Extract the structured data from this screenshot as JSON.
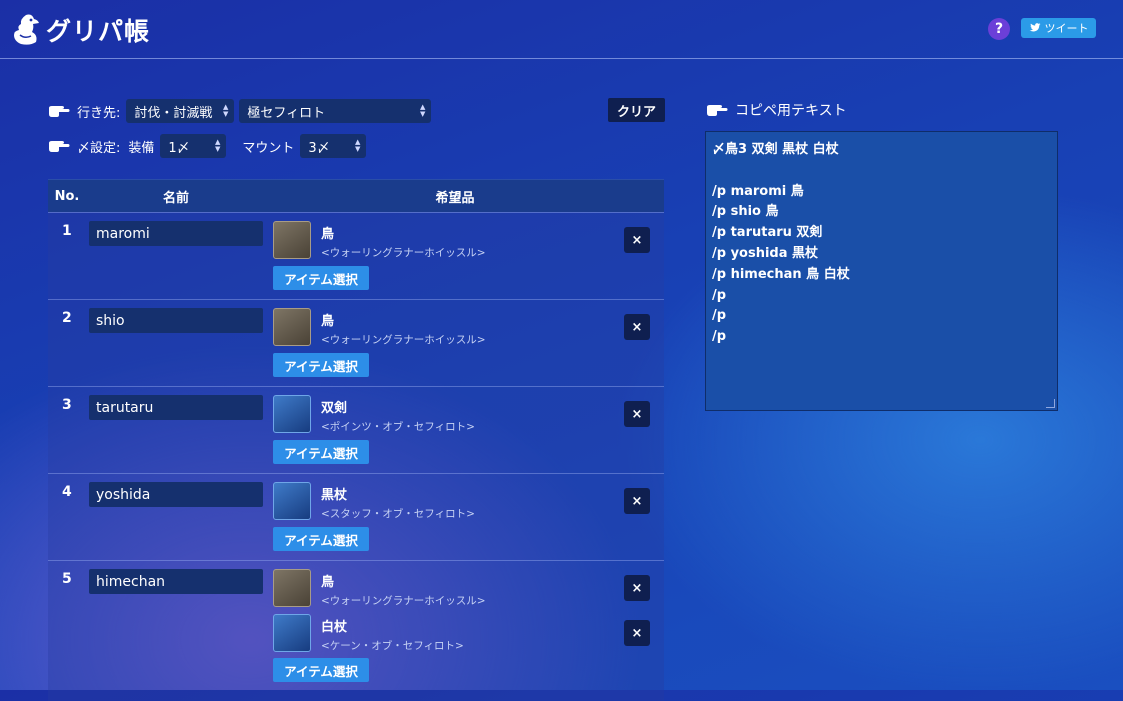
{
  "app": {
    "title": "グリパ帳",
    "help_label": "?",
    "tweet_label": "ツイート"
  },
  "controls": {
    "destination_label": "行き先:",
    "destination_category": "討伐・討滅戦",
    "destination_duty": "極セフィロト",
    "settings_label": "〆設定:",
    "equip_label": "装備",
    "equip_value": "1〆",
    "mount_label": "マウント",
    "mount_value": "3〆",
    "clear_label": "クリア"
  },
  "table": {
    "headers": {
      "no": "No.",
      "name": "名前",
      "wish": "希望品"
    },
    "pick_label": "アイテム選択",
    "remove_label": "×",
    "rows": [
      {
        "no": "1",
        "name": "maromi",
        "items": [
          {
            "name": "鳥",
            "sub": "<ウォーリングラナーホイッスル>",
            "icon": "whistle-icon"
          }
        ]
      },
      {
        "no": "2",
        "name": "shio",
        "items": [
          {
            "name": "鳥",
            "sub": "<ウォーリングラナーホイッスル>",
            "icon": "whistle-icon"
          }
        ]
      },
      {
        "no": "3",
        "name": "tarutaru",
        "items": [
          {
            "name": "双剣",
            "sub": "<ポインツ・オブ・セフィロト>",
            "icon": "twin-swords-icon"
          }
        ]
      },
      {
        "no": "4",
        "name": "yoshida",
        "items": [
          {
            "name": "黒杖",
            "sub": "<スタッフ・オブ・セフィロト>",
            "icon": "black-staff-icon"
          }
        ]
      },
      {
        "no": "5",
        "name": "himechan",
        "items": [
          {
            "name": "鳥",
            "sub": "<ウォーリングラナーホイッスル>",
            "icon": "whistle-icon"
          },
          {
            "name": "白杖",
            "sub": "<ケーン・オブ・セフィロト>",
            "icon": "white-cane-icon"
          }
        ]
      }
    ]
  },
  "copy": {
    "title": "コピペ用テキスト",
    "lines": [
      "〆鳥3 双剣 黒杖 白杖",
      "",
      "/p maromi 鳥",
      "/p shio 鳥",
      "/p tarutaru 双剣",
      "/p yoshida 黒杖",
      "/p himechan 鳥 白杖",
      "/p",
      "/p",
      "/p"
    ]
  },
  "colors": {
    "accent": "#2d8ee8",
    "dark_button": "#0f1f50",
    "help": "#6b3fd8",
    "tweet": "#2b9be8"
  }
}
